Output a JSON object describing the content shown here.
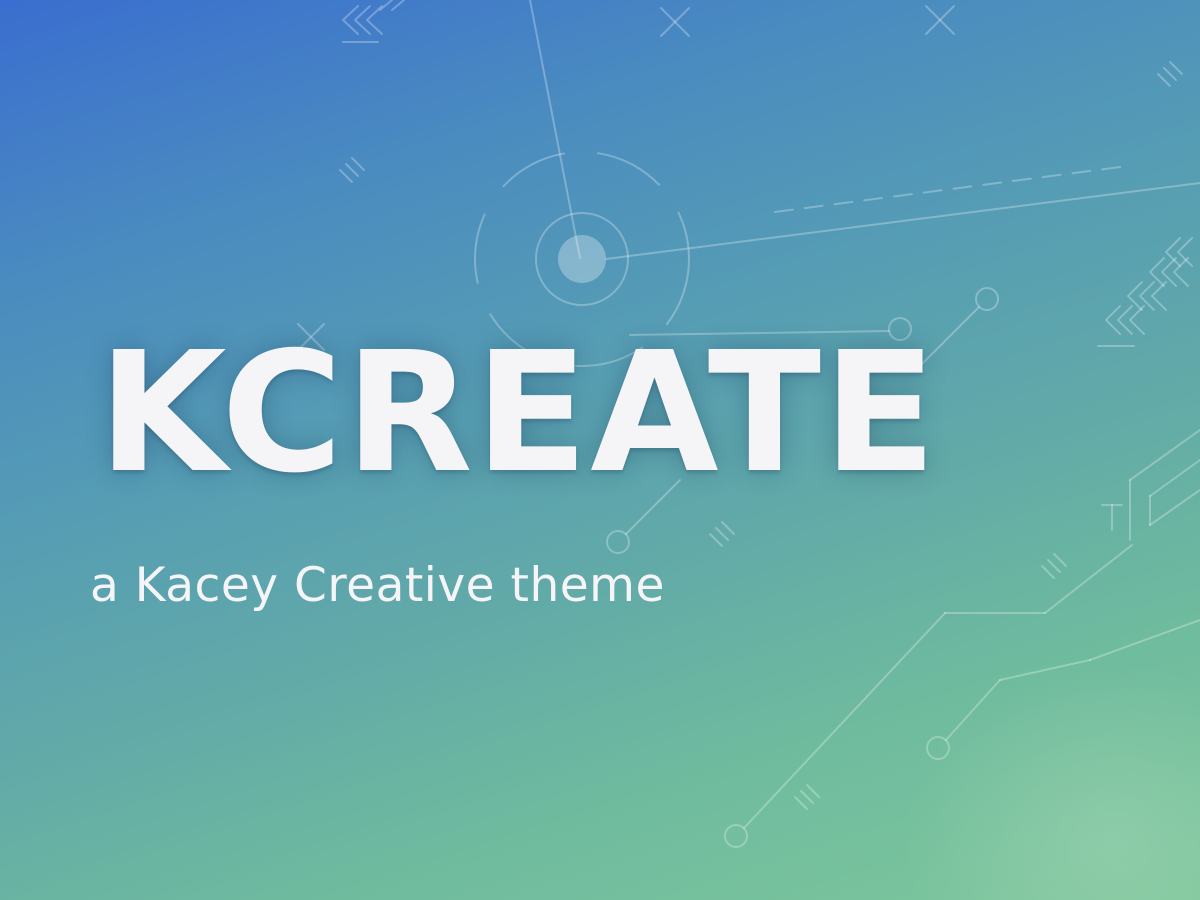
{
  "hero": {
    "title": "KCREATE",
    "tagline": "a Kacey Creative theme"
  },
  "colors": {
    "gradient_start": "#3a6ed0",
    "gradient_middle": "#569db4",
    "gradient_end": "#7ec79c",
    "text": "#f5f5f7",
    "decor_lines": "#ffffff"
  },
  "decor": {
    "icons": [
      "target-icon",
      "chevron-icon",
      "cross-icon",
      "tick-marks-icon",
      "circuit-node-icon"
    ]
  }
}
